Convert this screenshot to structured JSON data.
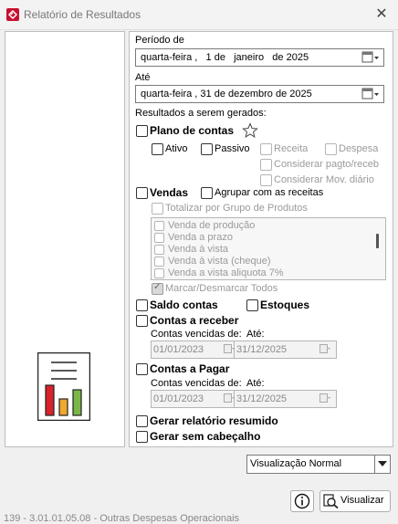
{
  "window": {
    "title": "Relatório de Resultados",
    "close_glyph": "✕"
  },
  "periodo": {
    "label": "Período de",
    "from_value": "quarta-feira ,   1 de   janeiro   de 2025",
    "to_label": "Até",
    "to_value": "quarta-feira , 31 de dezembro de 2025"
  },
  "results": {
    "heading": "Resultados a serem gerados:",
    "plano": {
      "label": "Plano de contas",
      "ativo": "Ativo",
      "passivo": "Passivo",
      "receita": "Receita",
      "despesa": "Despesa",
      "considerar_pagto": "Considerar pagto/receb",
      "considerar_mov": "Considerar Mov. diário"
    },
    "vendas": {
      "label": "Vendas",
      "agrupar": "Agrupar com as receitas",
      "totalizar": "Totalizar por Grupo de Produtos",
      "items": [
        "Venda de produção",
        "Venda a prazo",
        "Venda à vista",
        "Venda à vista (cheque)",
        "Venda a vista aliquota 7%"
      ],
      "marcar": "Marcar/Desmarcar Todos"
    },
    "saldo": "Saldo contas",
    "estoques": "Estoques",
    "receber": {
      "label": "Contas a receber",
      "vencidas": "Contas vencidas de:",
      "ate": "Até:",
      "from": "01/01/2023",
      "to": "31/12/2025"
    },
    "pagar": {
      "label": "Contas a Pagar",
      "vencidas": "Contas vencidas de:",
      "ate": "Até:",
      "from": "01/01/2023",
      "to": "31/12/2025"
    },
    "resumido": "Gerar relatório resumido",
    "sem_cabecalho": "Gerar sem cabeçalho"
  },
  "view_mode": {
    "selected": "Visualização Normal"
  },
  "buttons": {
    "visualizar": "Visualizar"
  },
  "background_row": "139 - 3.01.01.05.08  -  Outras Despesas Operacionais",
  "icons": [
    "app-icon",
    "close-icon",
    "calendar-icon",
    "star-icon",
    "report-chart-icon",
    "info-icon",
    "preview-icon",
    "dropdown-arrow-icon"
  ],
  "colors": {
    "bar1": "#d9222a",
    "bar2": "#f0a830",
    "bar3": "#7ab648",
    "app_icon": "#c8102e"
  }
}
